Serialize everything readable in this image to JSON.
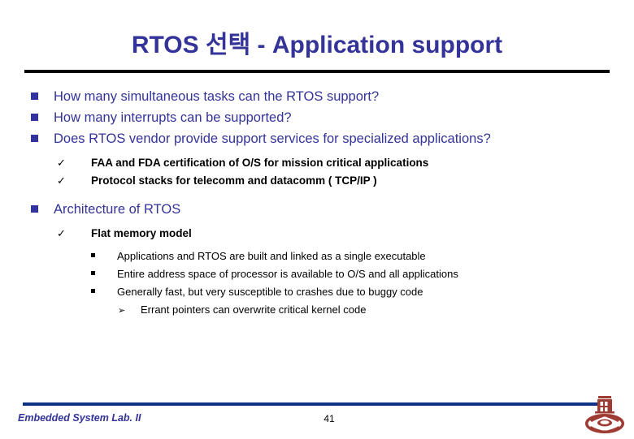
{
  "slide": {
    "title": "RTOS 선택 - Application support",
    "title_color": "#333399",
    "title_rule_color": "#000000",
    "background": "#ffffff"
  },
  "bullets": [
    {
      "level": 1,
      "marker": "filled-square",
      "text": "How many simultaneous tasks can the RTOS support?"
    },
    {
      "level": 1,
      "marker": "filled-square",
      "text": "How many interrupts can be supported?"
    },
    {
      "level": 1,
      "marker": "filled-square",
      "text": "Does RTOS vendor provide support services for specialized applications?"
    },
    {
      "level": 2,
      "marker": "check",
      "text": "FAA and FDA certification of O/S for mission critical applications"
    },
    {
      "level": 2,
      "marker": "check",
      "text": "Protocol stacks for telecomm and datacomm ( TCP/IP )"
    },
    {
      "level": 1,
      "marker": "filled-square",
      "text": "Architecture of RTOS"
    },
    {
      "level": 2,
      "marker": "check",
      "text": "Flat memory model"
    },
    {
      "level": 3,
      "marker": "small-square",
      "text": "Applications and RTOS are built and linked as a single executable"
    },
    {
      "level": 3,
      "marker": "small-square",
      "text": "Entire address space of processor is available to O/S and all applications"
    },
    {
      "level": 3,
      "marker": "small-square",
      "text": "Generally fast, but very susceptible to crashes due to buggy code"
    },
    {
      "level": 4,
      "marker": "arrow",
      "text": "Errant pointers can overwrite critical kernel code"
    }
  ],
  "markers": {
    "check": "✓",
    "arrow": "➢"
  },
  "footer": {
    "lab_name": "Embedded System Lab. II",
    "page_number": "41",
    "rule_color": "#0D3283",
    "text_color": "#333399",
    "logo_color": "#9E3B33",
    "logo_name": "university-emblem"
  }
}
